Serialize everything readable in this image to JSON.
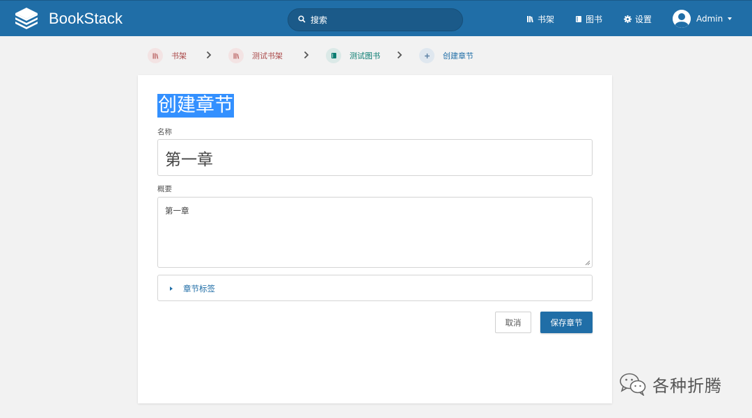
{
  "app": {
    "name": "BookStack"
  },
  "search": {
    "placeholder": "搜索"
  },
  "nav": {
    "shelves": "书架",
    "books": "图书",
    "settings": "设置"
  },
  "user": {
    "name": "Admin"
  },
  "breadcrumbs": [
    {
      "label": "书架",
      "color": "#a94747",
      "icon": "shelf-icon"
    },
    {
      "label": "测试书架",
      "color": "#a94747",
      "icon": "shelf-icon"
    },
    {
      "label": "测试图书",
      "color": "#077b70",
      "icon": "book-icon"
    },
    {
      "label": "创建章节",
      "color": "#206ea7",
      "icon": "plus-icon"
    }
  ],
  "form": {
    "title": "创建章节",
    "name_label": "名称",
    "name_value": "第一章",
    "description_label": "概要",
    "description_value": "第一章",
    "tags_label": "章节标签",
    "cancel_label": "取消",
    "save_label": "保存章节"
  },
  "colors": {
    "header": "#206ea7",
    "primary": "#206ea7",
    "selection": "#3390ff"
  },
  "watermark": {
    "text": "各种折腾"
  }
}
